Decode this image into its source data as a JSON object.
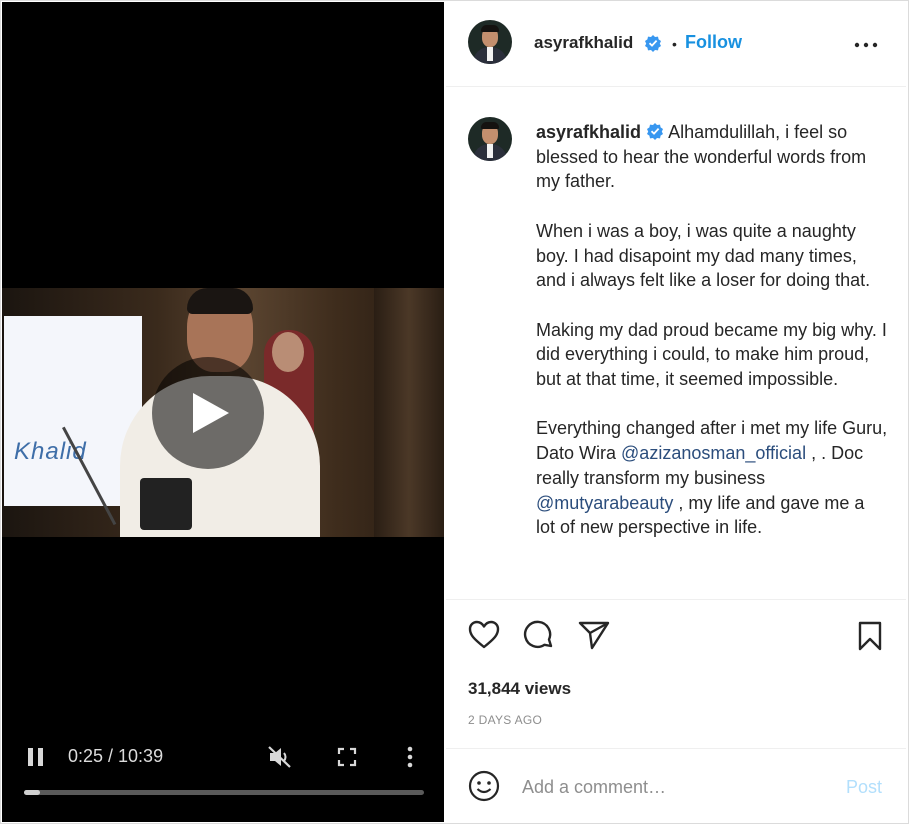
{
  "colors": {
    "accent": "#1891e0",
    "verified": "#3897f0",
    "text": "#262626",
    "muted": "#8e8e8e",
    "post_disabled": "#b2dffc"
  },
  "video": {
    "frame_text": "Khalid",
    "time": "0:25 / 10:39",
    "progress": 0.04,
    "icons": [
      "play-icon",
      "pause-icon",
      "mute-icon",
      "fullscreen-icon",
      "more-vertical-icon"
    ]
  },
  "header": {
    "username": "asyrafkhalid",
    "separator": "•",
    "follow_label": "Follow"
  },
  "caption": {
    "username": "asyrafkhalid",
    "paragraph1": "Alhamdulillah, i feel so blessed to hear the wonderful words from my father.",
    "paragraph2": "When i was a boy, i was quite a naughty boy. I had disapoint my dad many times, and i always felt like a loser for doing that.",
    "paragraph3": "Making my dad proud became my big why. I did everything i could, to make him proud, but at that time, it seemed impossible.",
    "paragraph4_part1": "Everything changed after i met my life Guru, Dato Wira ",
    "mention1": "@azizanosman_official",
    "paragraph4_part2": " , . Doc really transform my business ",
    "mention2": "@mutyarabeauty",
    "paragraph4_part3": " , my life and gave me a lot of new perspective in life."
  },
  "actions": {
    "views": "31,844 views",
    "time_ago": "2 DAYS AGO"
  },
  "comment": {
    "placeholder": "Add a comment…",
    "post_label": "Post"
  }
}
